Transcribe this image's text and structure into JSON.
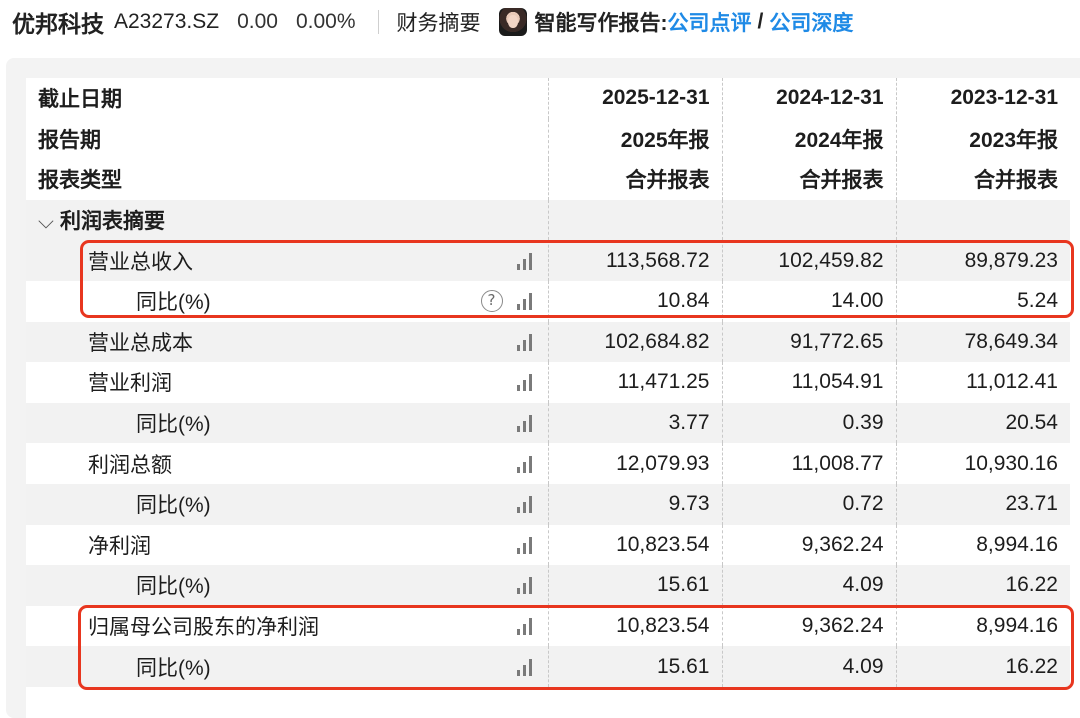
{
  "header": {
    "company_name": "优邦科技",
    "stock_code": "A23273.SZ",
    "price": "0.00",
    "change_pct": "0.00%",
    "section_title": "财务摘要",
    "ai_label": "智能写作报告:",
    "link_comment": "公司点评",
    "separator": "/",
    "link_depth": "公司深度"
  },
  "table": {
    "header_rows": [
      {
        "label": "截止日期",
        "values": [
          "2025-12-31",
          "2024-12-31",
          "2023-12-31"
        ]
      },
      {
        "label": "报告期",
        "values": [
          "2025年报",
          "2024年报",
          "2023年报"
        ]
      },
      {
        "label": "报表类型",
        "values": [
          "合并报表",
          "合并报表",
          "合并报表"
        ]
      }
    ],
    "group": {
      "label": "利润表摘要",
      "chevron": "⌵"
    },
    "rows": [
      {
        "label": "营业总收入",
        "values": [
          "113,568.72",
          "102,459.82",
          "89,879.23"
        ]
      },
      {
        "label": "同比(%)",
        "values": [
          "10.84",
          "14.00",
          "5.24"
        ],
        "help": "?"
      },
      {
        "label": "营业总成本",
        "values": [
          "102,684.82",
          "91,772.65",
          "78,649.34"
        ]
      },
      {
        "label": "营业利润",
        "values": [
          "11,471.25",
          "11,054.91",
          "11,012.41"
        ]
      },
      {
        "label": "同比(%)",
        "values": [
          "3.77",
          "0.39",
          "20.54"
        ]
      },
      {
        "label": "利润总额",
        "values": [
          "12,079.93",
          "11,008.77",
          "10,930.16"
        ]
      },
      {
        "label": "同比(%)",
        "values": [
          "9.73",
          "0.72",
          "23.71"
        ]
      },
      {
        "label": "净利润",
        "values": [
          "10,823.54",
          "9,362.24",
          "8,994.16"
        ]
      },
      {
        "label": "同比(%)",
        "values": [
          "15.61",
          "4.09",
          "16.22"
        ]
      },
      {
        "label": "归属母公司股东的净利润",
        "values": [
          "10,823.54",
          "9,362.24",
          "8,994.16"
        ]
      },
      {
        "label": "同比(%)",
        "values": [
          "15.61",
          "4.09",
          "16.22"
        ]
      }
    ]
  },
  "colors": {
    "link": "#1f8ae6",
    "highlight": "#e8361f",
    "shade": "#f2f2f2",
    "panel": "#f3f3f3"
  }
}
